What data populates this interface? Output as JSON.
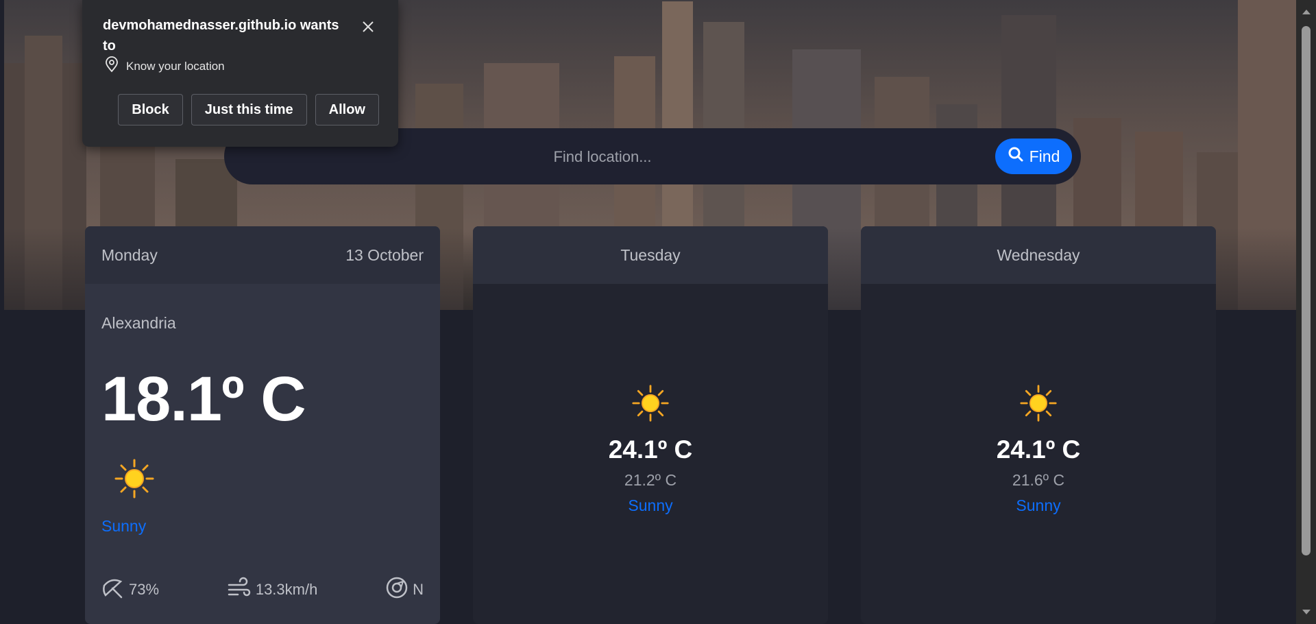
{
  "permission_prompt": {
    "title": "devmohamednasser.github.io wants to",
    "permission": "Know your location",
    "buttons": {
      "block": "Block",
      "just_this_time": "Just this time",
      "allow": "Allow"
    }
  },
  "search": {
    "placeholder": "Find location...",
    "button_label": "Find"
  },
  "today": {
    "day": "Monday",
    "date": "13 October",
    "location": "Alexandria",
    "temperature": "18.1º C",
    "condition": "Sunny",
    "condition_icon": "sun-icon",
    "humidity": "73%",
    "wind_speed": "13.3km/h",
    "wind_direction": "N"
  },
  "forecast": [
    {
      "day": "Tuesday",
      "max_temp": "24.1º C",
      "min_temp": "21.2º C",
      "condition": "Sunny",
      "condition_icon": "sun-icon"
    },
    {
      "day": "Wednesday",
      "max_temp": "24.1º C",
      "min_temp": "21.6º C",
      "condition": "Sunny",
      "condition_icon": "sun-icon"
    }
  ],
  "colors": {
    "accent": "#0d6efd",
    "card_bg": "#323543",
    "card_header_bg": "#2c2f3c",
    "page_bg": "#1e202b",
    "popup_bg": "#2a2b2f"
  }
}
